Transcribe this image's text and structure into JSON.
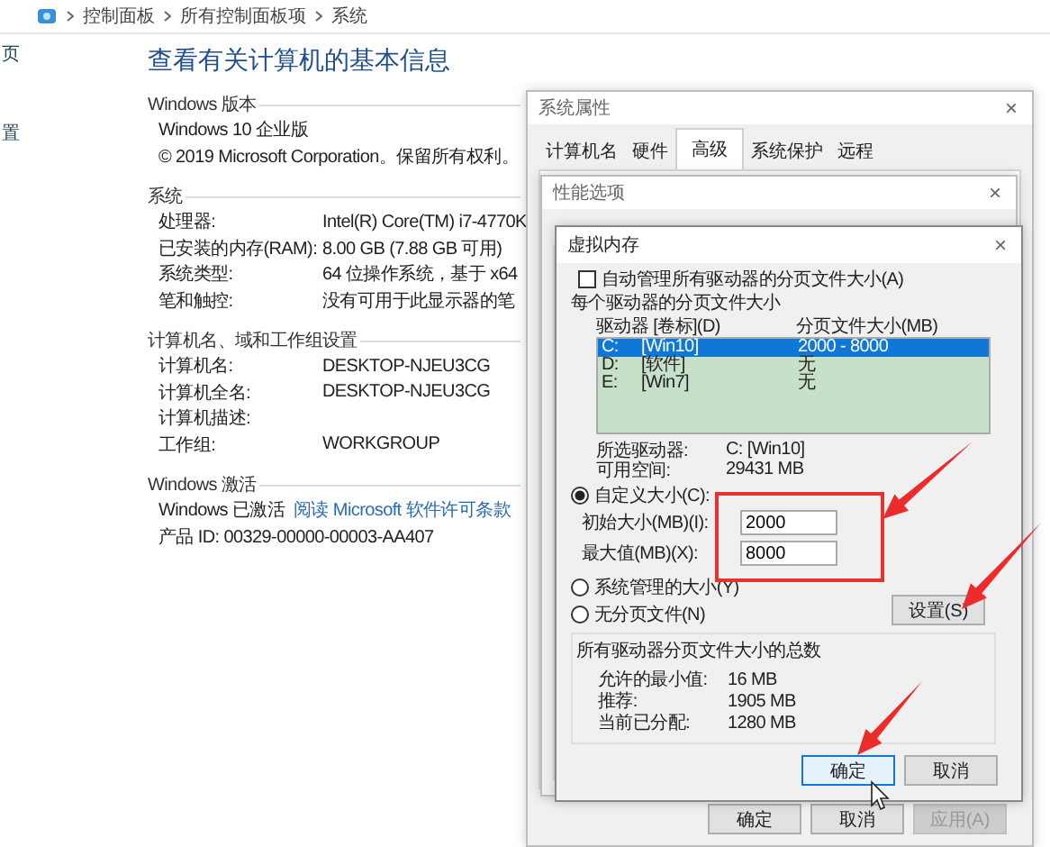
{
  "breadcrumb": [
    "控制面板",
    "所有控制面板项",
    "系统"
  ],
  "sidebar": {
    "items": [
      "页",
      "置"
    ]
  },
  "page": {
    "title": "查看有关计算机的基本信息",
    "sections": [
      {
        "heading": "Windows 版本",
        "rows": [
          {
            "value": "Windows 10 企业版"
          },
          {
            "value": "© 2019 Microsoft Corporation。保留所有权利。"
          }
        ]
      },
      {
        "heading": "系统",
        "rows": [
          {
            "label": "处理器:",
            "value": "Intel(R) Core(TM) i7-4770K"
          },
          {
            "label": "已安装的内存(RAM):",
            "value": "8.00 GB (7.88 GB 可用)"
          },
          {
            "label": "系统类型:",
            "value": "64 位操作系统，基于 x64"
          },
          {
            "label": "笔和触控:",
            "value": "没有可用于此显示器的笔"
          }
        ]
      },
      {
        "heading": "计算机名、域和工作组设置",
        "rows": [
          {
            "label": "计算机名:",
            "value": "DESKTOP-NJEU3CG"
          },
          {
            "label": "计算机全名:",
            "value": "DESKTOP-NJEU3CG"
          },
          {
            "label": "计算机描述:"
          },
          {
            "label": "工作组:",
            "value": "WORKGROUP"
          }
        ]
      },
      {
        "heading": "Windows 激活",
        "rows": [
          {
            "value": "Windows 已激活",
            "link": "阅读 Microsoft 软件许可条款"
          },
          {
            "value": "产品 ID: 00329-00000-00003-AA407"
          }
        ]
      }
    ]
  },
  "system_properties": {
    "title": "系统属性",
    "close": "×",
    "tabs": [
      {
        "label": "计算机名",
        "selected": false
      },
      {
        "label": "硬件",
        "selected": false
      },
      {
        "label": "高级",
        "selected": true
      },
      {
        "label": "系统保护",
        "selected": false
      },
      {
        "label": "远程",
        "selected": false
      }
    ],
    "buttons": [
      {
        "label": "确定",
        "disabled": false
      },
      {
        "label": "取消",
        "disabled": false
      },
      {
        "label": "应用(A)",
        "disabled": true
      }
    ]
  },
  "performance_options": {
    "title": "性能选项",
    "close": "×"
  },
  "virtual_memory": {
    "title": "虚拟内存",
    "close": "×",
    "auto_manage": {
      "label": "自动管理所有驱动器的分页文件大小(A)",
      "checked": false
    },
    "drives_label": "每个驱动器的分页文件大小",
    "columns": [
      "驱动器 [卷标](D)",
      "分页文件大小(MB)"
    ],
    "drives": [
      {
        "drive": "C:",
        "volume": "[Win10]",
        "size": "2000 - 8000",
        "selected": true
      },
      {
        "drive": "D:",
        "volume": "[软件]",
        "size": "无",
        "selected": false
      },
      {
        "drive": "E:",
        "volume": "[Win7]",
        "size": "无",
        "selected": false
      }
    ],
    "selected_drive": {
      "label": "所选驱动器:",
      "value": "C:  [Win10]"
    },
    "free_space": {
      "label": "可用空间:",
      "value": "29431 MB"
    },
    "options": [
      {
        "label": "自定义大小(C):",
        "selected": true
      },
      {
        "label": "系统管理的大小(Y)",
        "selected": false
      },
      {
        "label": "无分页文件(N)",
        "selected": false
      }
    ],
    "initial_size": {
      "label": "初始大小(MB)(I):",
      "value": "2000"
    },
    "max_size": {
      "label": "最大值(MB)(X):",
      "value": "8000"
    },
    "set_button": "设置(S)",
    "totals": {
      "heading": "所有驱动器分页文件大小的总数",
      "rows": [
        {
          "label": "允许的最小值:",
          "value": "16 MB"
        },
        {
          "label": "推荐:",
          "value": "1905 MB"
        },
        {
          "label": "当前已分配:",
          "value": "1280 MB"
        }
      ]
    },
    "buttons": [
      {
        "label": "确定",
        "focused": true
      },
      {
        "label": "取消",
        "focused": false
      }
    ]
  }
}
